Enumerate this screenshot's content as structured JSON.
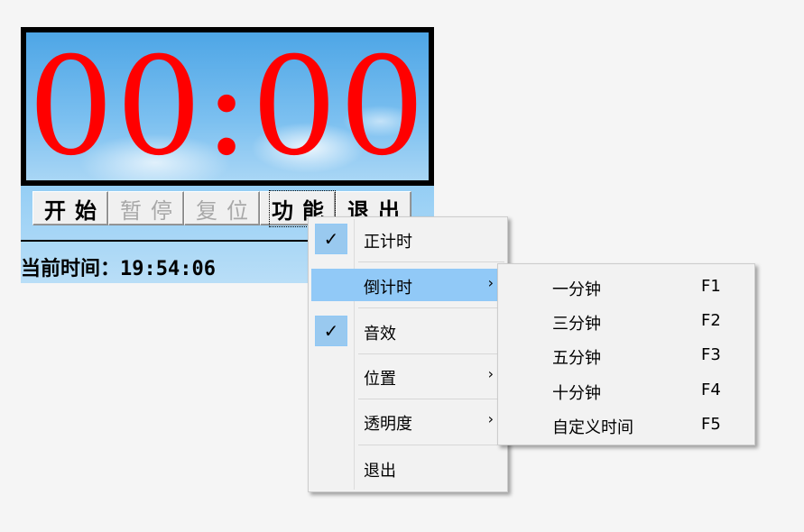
{
  "display": {
    "time": "00:00"
  },
  "buttons": [
    {
      "label": "开始",
      "enabled": true
    },
    {
      "label": "暂停",
      "enabled": false
    },
    {
      "label": "复位",
      "enabled": false
    },
    {
      "label": "功能",
      "enabled": true,
      "focused": true
    },
    {
      "label": "退出",
      "enabled": true
    }
  ],
  "status": {
    "current_time": "当前时间：19:54:06"
  },
  "menu": {
    "items": [
      {
        "label": "正计时",
        "checked": true,
        "submenu": false
      },
      {
        "label": "倒计时",
        "checked": false,
        "submenu": true,
        "highlighted": true
      },
      {
        "label": "音效",
        "checked": true,
        "submenu": false
      },
      {
        "label": "位置",
        "checked": false,
        "submenu": true
      },
      {
        "label": "透明度",
        "checked": false,
        "submenu": true
      },
      {
        "label": "退出",
        "checked": false,
        "submenu": false
      }
    ],
    "check_glyph": "✓",
    "arrow_glyph": "›"
  },
  "submenu": {
    "items": [
      {
        "label": "一分钟",
        "shortcut": "F1"
      },
      {
        "label": "三分钟",
        "shortcut": "F2"
      },
      {
        "label": "五分钟",
        "shortcut": "F3"
      },
      {
        "label": "十分钟",
        "shortcut": "F4"
      },
      {
        "label": "自定义时间",
        "shortcut": "F5"
      }
    ]
  },
  "colors": {
    "digits": "#ff0000",
    "menu_highlight": "#91c9f7",
    "check_box": "#99c9ef"
  }
}
